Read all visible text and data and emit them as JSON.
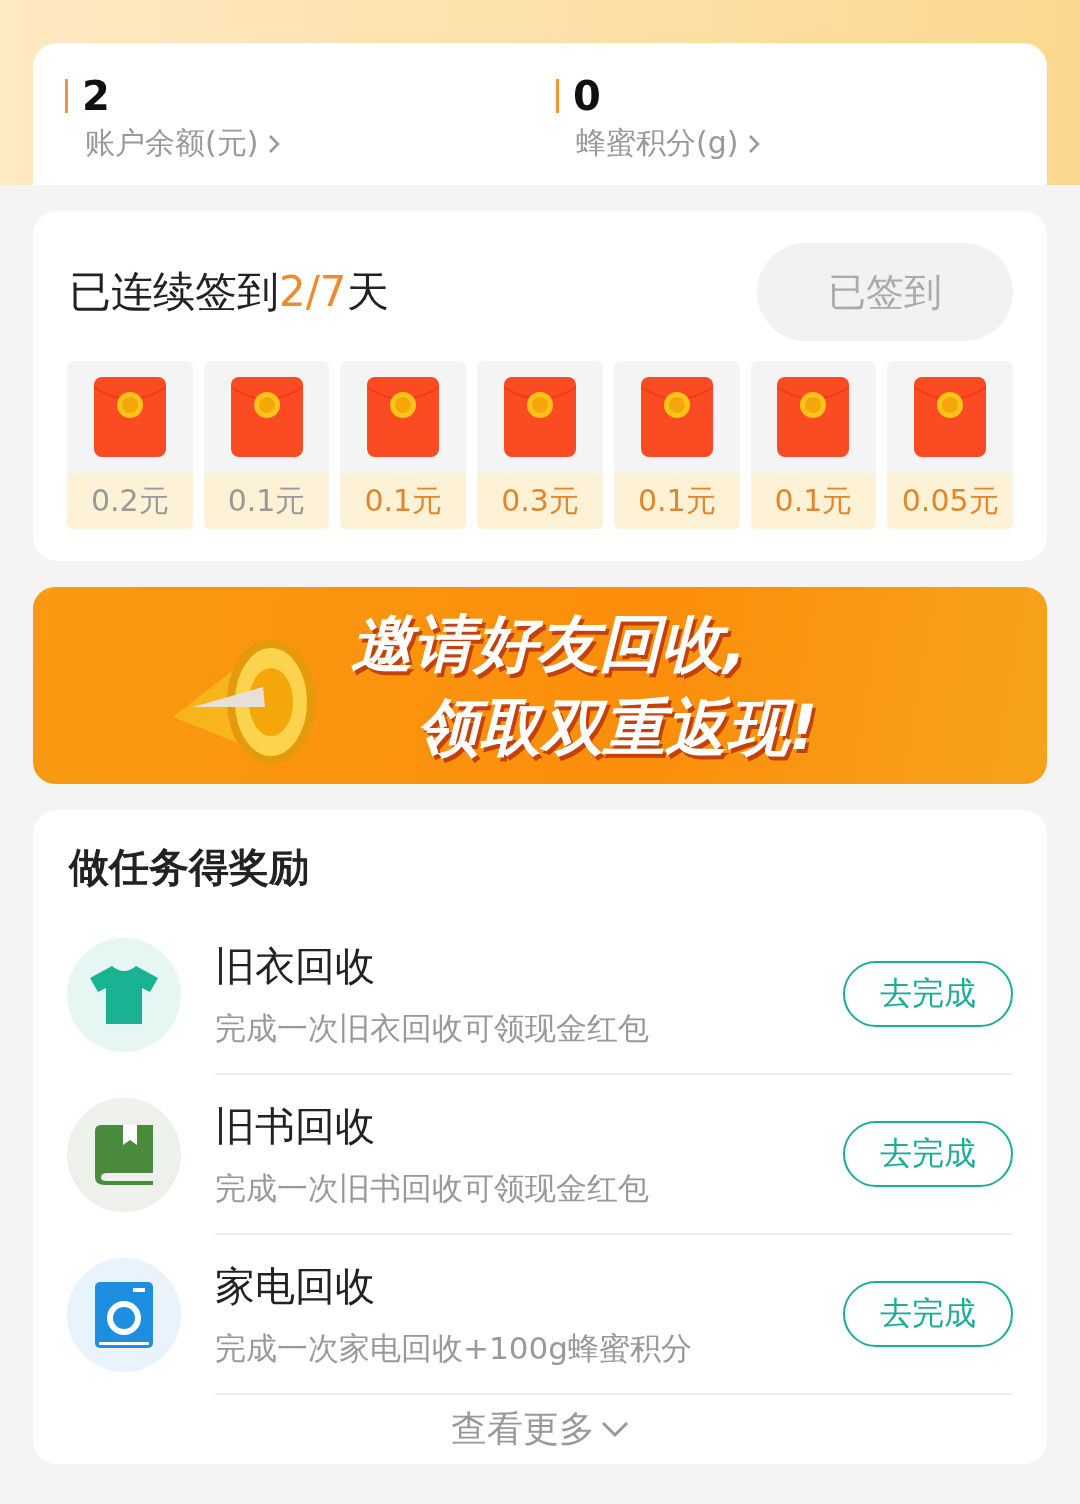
{
  "balances": [
    {
      "value": "2",
      "label": "账户余额(元)"
    },
    {
      "value": "0",
      "label": "蜂蜜积分(g)"
    }
  ],
  "checkin": {
    "title_prefix": "已连续签到",
    "progress": "2/7",
    "title_suffix": "天",
    "button": "已签到",
    "button_disabled": true,
    "days": [
      {
        "amount": "0.2元",
        "claimed": true
      },
      {
        "amount": "0.1元",
        "claimed": true
      },
      {
        "amount": "0.1元",
        "claimed": false
      },
      {
        "amount": "0.3元",
        "claimed": false
      },
      {
        "amount": "0.1元",
        "claimed": false
      },
      {
        "amount": "0.1元",
        "claimed": false
      },
      {
        "amount": "0.05元",
        "claimed": false
      }
    ]
  },
  "banner": {
    "lines": [
      "邀请好友回收,",
      "领取双重返现!"
    ]
  },
  "tasks": {
    "title": "做任务得奖励",
    "items": [
      {
        "kind": "clothes",
        "name": "旧衣回收",
        "desc": "完成一次旧衣回收可领现金红包",
        "button": "去完成"
      },
      {
        "kind": "book",
        "name": "旧书回收",
        "desc": "完成一次旧书回收可领现金红包",
        "button": "去完成"
      },
      {
        "kind": "appliance",
        "name": "家电回收",
        "desc": "完成一次家电回收+100g蜂蜜积分",
        "button": "去完成"
      }
    ],
    "more": "查看更多"
  }
}
